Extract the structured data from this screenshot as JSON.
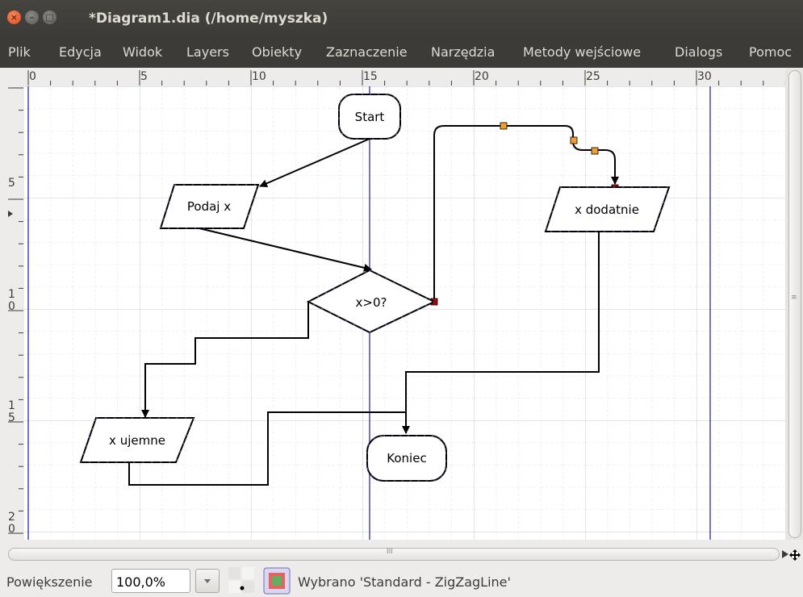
{
  "window": {
    "title": "*Diagram1.dia (/home/myszka)",
    "close_glyph": "×",
    "min_glyph": "–",
    "max_glyph": "□"
  },
  "menu": [
    "Plik",
    "Edycja",
    "Widok",
    "Layers",
    "Obiekty",
    "Zaznaczenie",
    "Narzędzia",
    "Metody wejściowe",
    "Dialogs",
    "Pomoc"
  ],
  "ruler": {
    "horizontal_labels": [
      "0",
      "5",
      "10",
      "15",
      "20",
      "25",
      "30"
    ],
    "vertical_labels": [
      {
        "top": "5",
        "bottom": ""
      },
      {
        "top": "1",
        "bottom": "0"
      },
      {
        "top": "1",
        "bottom": "5"
      },
      {
        "top": "2",
        "bottom": "0"
      }
    ]
  },
  "diagram": {
    "nodes": {
      "start": "Start",
      "input": "Podaj x",
      "decision": "x>0?",
      "positive": "x dodatnie",
      "negative": "x ujemne",
      "end": "Koniec"
    }
  },
  "colors": {
    "titlebar": "#3c3b37",
    "close_button": "#df4a16",
    "guide": "#1a1a8c",
    "handle_orange": "#f0a030",
    "handle_red": "#c00000",
    "grid": "#d4dde4"
  },
  "scrollbar": {
    "hscroll_grip": "III",
    "vscroll_grip": "≡"
  },
  "statusbar": {
    "zoom_label": "Powiększenie",
    "zoom_value": "100,0%",
    "selection_text": "Wybrano 'Standard - ZigZagLine'"
  }
}
